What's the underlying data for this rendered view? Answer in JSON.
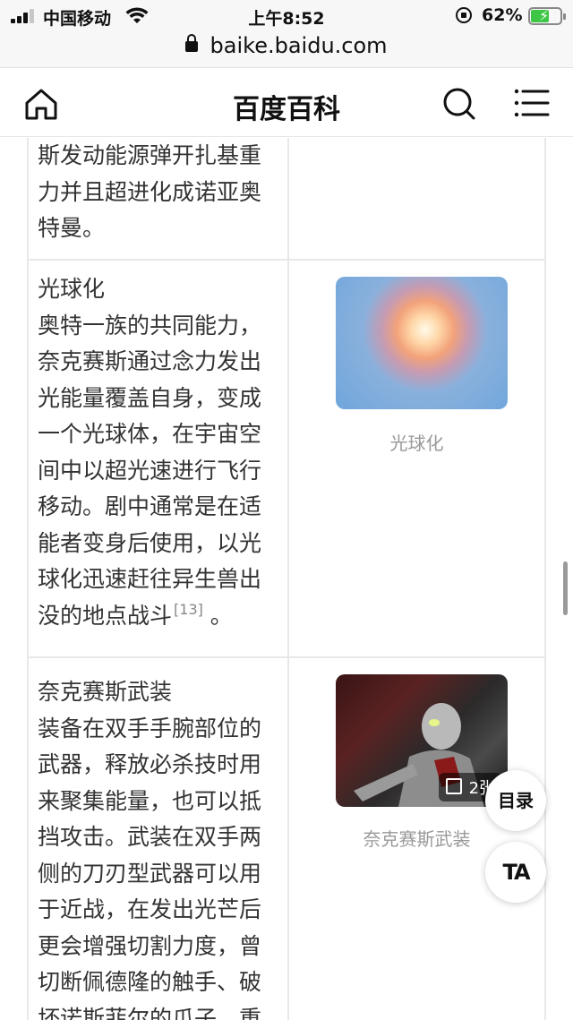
{
  "status_bar": {
    "carrier": "中国移动",
    "time": "上午8:52",
    "battery": "62%"
  },
  "browser": {
    "url": "baike.baidu.com"
  },
  "header": {
    "title": "百度百科",
    "icons": [
      "home-icon",
      "search-icon",
      "menu-icon"
    ]
  },
  "table": {
    "rows": [
      {
        "text": "斯发动能源弹开扎基重力并且超进化成诺亚奥特曼。"
      },
      {
        "title": "光球化",
        "text": "奥特一族的共同能力，奈克赛斯通过念力发出光能量覆盖自身，变成一个光球体，在宇宙空间中以超光速进行飞行移动。剧中通常是在适能者变身后使用，以光球化迅速赶往异生兽出没的地点战斗",
        "ref": "[13]",
        "tail": " 。",
        "image_caption": "光球化"
      },
      {
        "title": "奈克赛斯武装",
        "text": "装备在双手手腕部位的武器，释放必杀技时用来聚集能量，也可以抵挡攻击。武装在双手两侧的刀刃型武器可以用于近战，在发出光芒后更会增强切割力度，曾切断佩德隆的触手、破坏诺斯菲尔的爪子，重",
        "image_count": "2张",
        "image_caption": "奈克赛斯武装"
      }
    ]
  },
  "floating": {
    "toc_label": "目录",
    "ta_label": "TA"
  }
}
